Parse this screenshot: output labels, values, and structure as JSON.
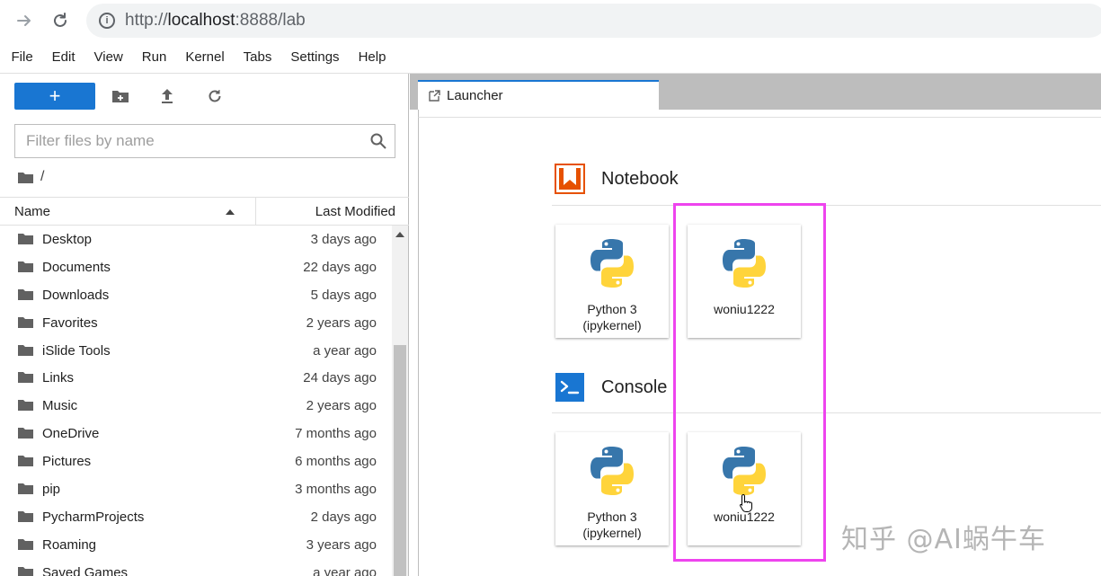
{
  "browser": {
    "url_prefix": "http://",
    "url_host": "localhost",
    "url_rest": ":8888/lab"
  },
  "menu": [
    "File",
    "Edit",
    "View",
    "Run",
    "Kernel",
    "Tabs",
    "Settings",
    "Help"
  ],
  "sidebar": {
    "new_button_label": "+",
    "filter_placeholder": "Filter files by name",
    "breadcrumb": "/",
    "column_name": "Name",
    "column_modified": "Last Modified",
    "files": [
      {
        "name": "Desktop",
        "modified": "3 days ago"
      },
      {
        "name": "Documents",
        "modified": "22 days ago"
      },
      {
        "name": "Downloads",
        "modified": "5 days ago"
      },
      {
        "name": "Favorites",
        "modified": "2 years ago"
      },
      {
        "name": "iSlide Tools",
        "modified": "a year ago"
      },
      {
        "name": "Links",
        "modified": "24 days ago"
      },
      {
        "name": "Music",
        "modified": "2 years ago"
      },
      {
        "name": "OneDrive",
        "modified": "7 months ago"
      },
      {
        "name": "Pictures",
        "modified": "6 months ago"
      },
      {
        "name": "pip",
        "modified": "3 months ago"
      },
      {
        "name": "PycharmProjects",
        "modified": "2 days ago"
      },
      {
        "name": "Roaming",
        "modified": "3 years ago"
      },
      {
        "name": "Saved Games",
        "modified": "a year ago"
      }
    ]
  },
  "main": {
    "tab_label": "Launcher",
    "notebook_section": "Notebook",
    "console_section": "Console",
    "notebook_kernels": [
      {
        "line1": "Python 3",
        "line2": "(ipykernel)"
      },
      {
        "line1": "woniu1222",
        "line2": ""
      }
    ],
    "console_kernels": [
      {
        "line1": "Python 3",
        "line2": "(ipykernel)"
      },
      {
        "line1": "woniu1222",
        "line2": ""
      }
    ]
  },
  "colors": {
    "accent": "#1976d2",
    "notebook_icon": "#e65100",
    "highlight_box": "#ee44ee"
  },
  "watermark": "知乎 @AI蜗牛车"
}
